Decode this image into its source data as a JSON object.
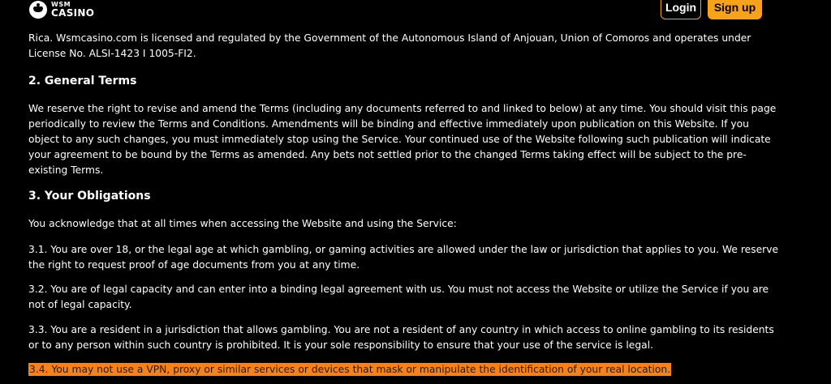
{
  "header": {
    "logo_small": "WSM",
    "logo_big": "CASINO",
    "login_label": "Login",
    "signup_label": "Sign up"
  },
  "intro": {
    "lines": [
      "Rica. Wsmcasino.com is licensed and regulated by the Government of the Autonomous Island of Anjouan, Union of Comoros and operates under",
      "License No. ALSI-1423 I 1005-FI2."
    ]
  },
  "sections": {
    "general": {
      "heading": "2. General Terms",
      "lines": [
        "We reserve the right to revise and amend the Terms (including any documents referred to and linked to below) at any time. You should visit this page",
        "periodically to review the Terms and Conditions. Amendments will be binding and effective immediately upon publication on this Website. If you",
        "object to any such changes, you must immediately stop using the Service. Your continued use of the Website following such publication will indicate",
        "your agreement to be bound by the Terms as amended. Any bets not settled prior to the changed Terms taking effect will be subject to the pre-",
        "existing Terms."
      ]
    },
    "obligations": {
      "heading": "3. Your Obligations",
      "intro": "You acknowledge that at all times when accessing the Website and using the Service:",
      "p31": [
        "3.1. You are over 18, or the legal age at which gambling, or gaming activities are allowed under the law or jurisdiction that applies to you. We reserve",
        "the right to request proof of age documents from you at any time."
      ],
      "p32": [
        "3.2. You are of legal capacity and can enter into a binding legal agreement with us. You must not access the Website or utilize the Service if you are",
        "not of legal capacity."
      ],
      "p33": [
        "3.3. You are a resident in a jurisdiction that allows gambling. You are not a resident of any country in which access to online gambling to its residents",
        "or to any person within such country is prohibited. It is your sole responsibility to ensure that your use of the service is legal."
      ],
      "p34": "3.4. You may not use a VPN, proxy or similar services or devices that mask or manipulate the identification of your real location."
    }
  },
  "colors": {
    "accent": "#f7a21b",
    "highlight": "#f7821b",
    "background": "#000000"
  }
}
